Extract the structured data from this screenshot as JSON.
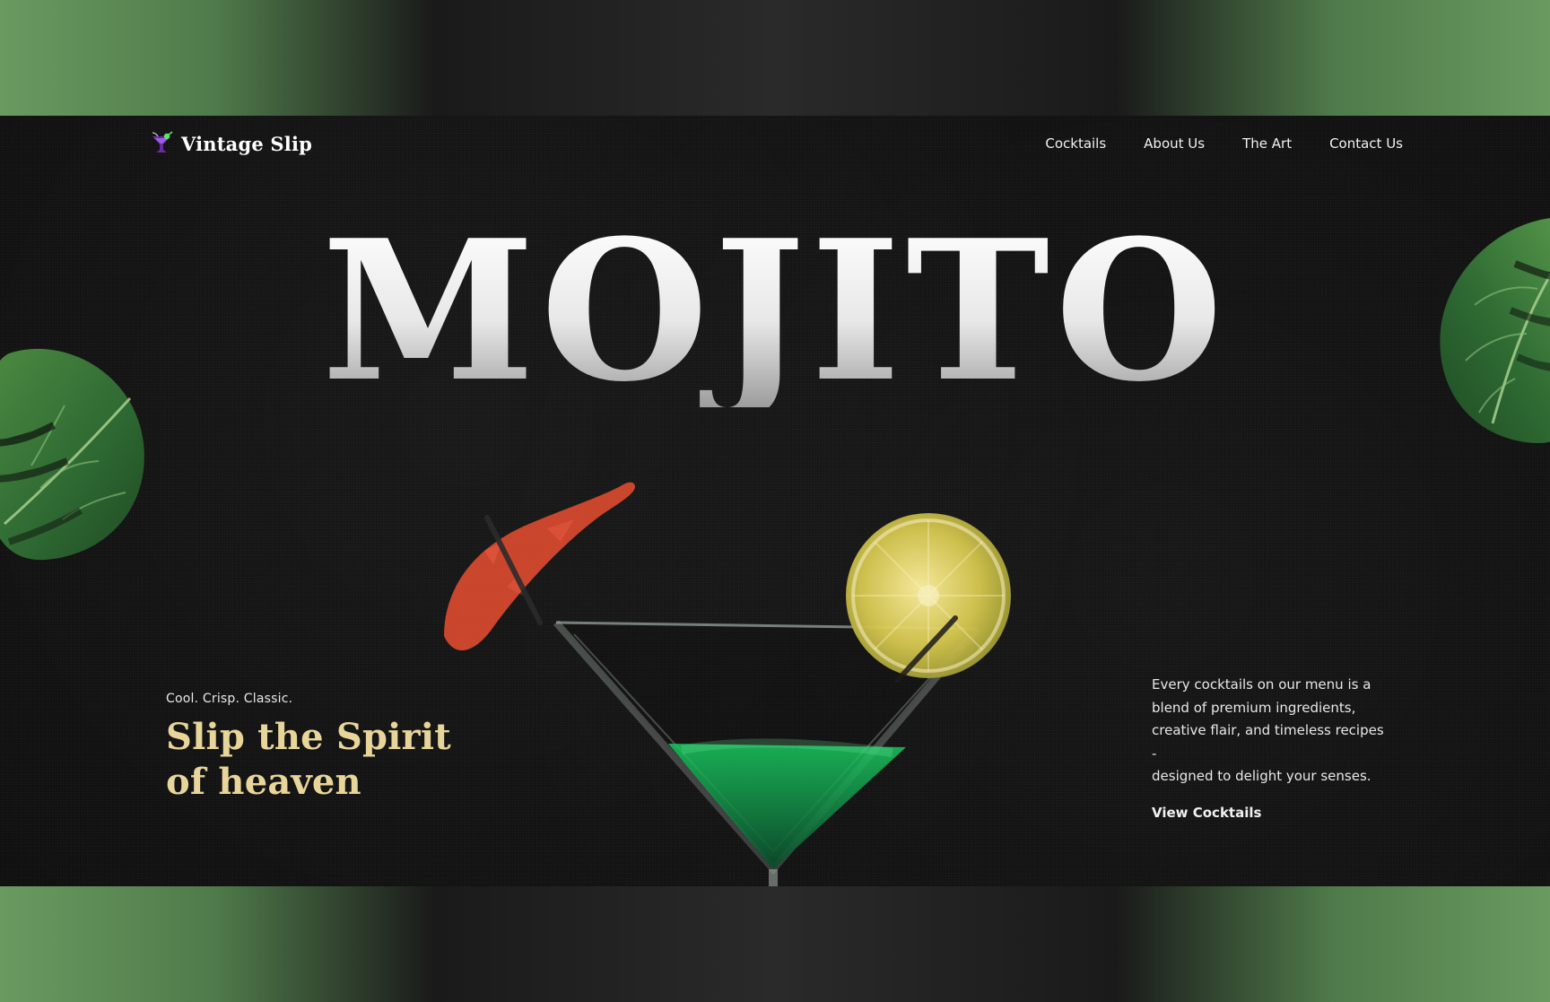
{
  "brand": {
    "name": "Vintage Slip",
    "icon": "cocktail-glass-icon"
  },
  "nav": {
    "items": [
      {
        "label": "Cocktails"
      },
      {
        "label": "About Us"
      },
      {
        "label": "The Art"
      },
      {
        "label": "Contact Us"
      }
    ]
  },
  "hero": {
    "title": "MOJITO",
    "subtitle": "Cool. Crisp. Classic.",
    "headline_line1": "Slip the Spirit",
    "headline_line2": "of heaven",
    "description": "Every cocktails on our menu is a\nblend of premium ingredients,\ncreative flair, and timeless recipes\n-\ndesigned to delight your senses.",
    "cta_label": "View Cocktails"
  },
  "colors": {
    "background": "#0f0f0f",
    "accent": "#e8d59a",
    "frame_green": "#6a9a60",
    "umbrella_red": "#d94a2f",
    "lime": "#d7c84f",
    "drink_green": "#19a34f"
  },
  "decor": {
    "left_leaf_icon": "monstera-leaf-icon",
    "right_leaf_icon": "monstera-leaf-icon",
    "drink_image": "martini-glass-image",
    "umbrella_icon": "cocktail-umbrella-icon",
    "lime_icon": "lime-slice-icon"
  }
}
